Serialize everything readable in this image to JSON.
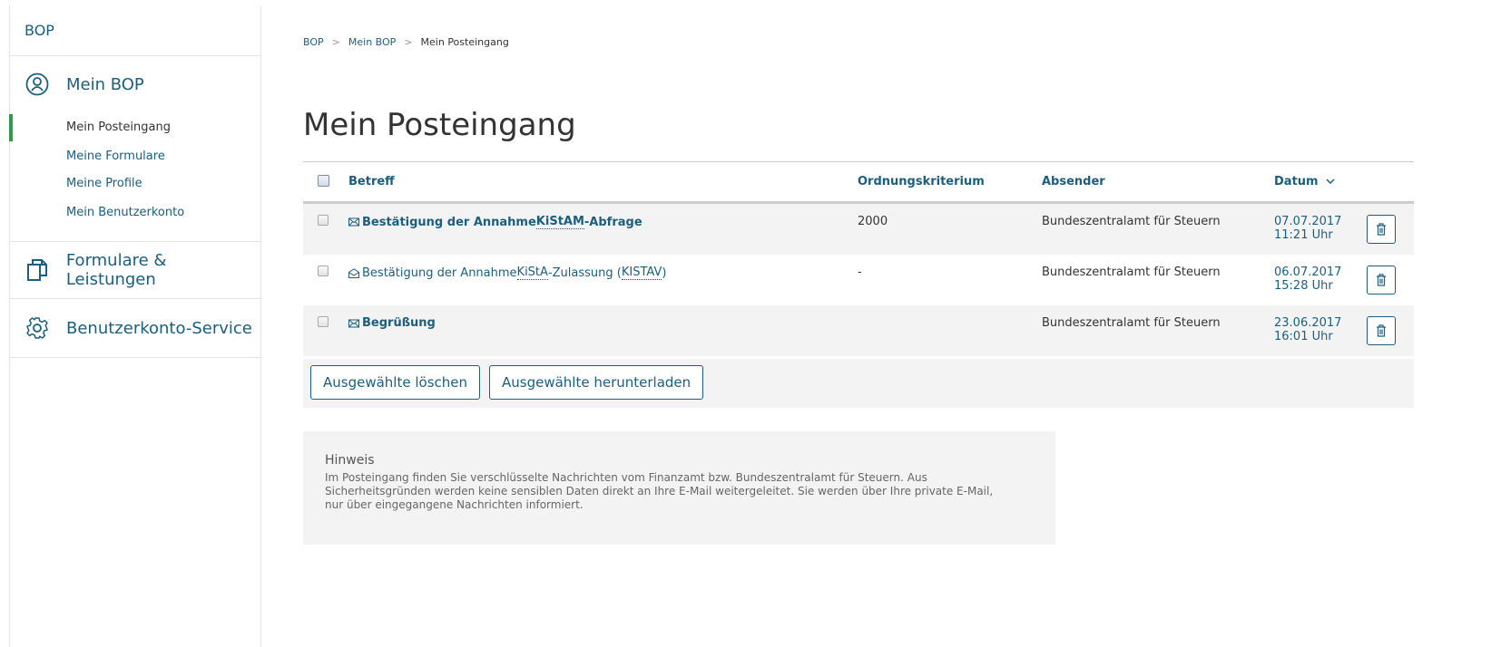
{
  "sidebar": {
    "brand": "BOP",
    "sections": [
      {
        "label": "Mein BOP",
        "icon": "user-circle-icon"
      },
      {
        "label": "Formulare & Leistungen",
        "icon": "documents-icon"
      },
      {
        "label": "Benutzerkonto-Service",
        "icon": "gear-icon"
      }
    ],
    "subnav": [
      "Mein Posteingang",
      "Meine Formulare",
      "Meine Profile",
      "Mein Benutzerkonto"
    ],
    "active": "Mein Posteingang"
  },
  "breadcrumb": [
    "BOP",
    "Mein BOP",
    "Mein Posteingang"
  ],
  "page_title": "Mein Posteingang",
  "table": {
    "headers": {
      "subject": "Betreff",
      "criterion": "Ordnungskriterium",
      "sender": "Absender",
      "date": "Datum"
    },
    "sort_icon": "chevron-down-icon",
    "rows": [
      {
        "subject_pre": "Bestätigung der Annahme ",
        "subject_abbr": "KiStAM",
        "subject_post": "-Abfrage",
        "criterion": "2000",
        "sender": "Bundeszentralamt für Steuern",
        "date": "07.07.2017",
        "time": "11:21 Uhr",
        "read": false,
        "icon": "envelope-icon"
      },
      {
        "subject_pre": "Bestätigung der Annahme ",
        "subject_abbr": "KiStA",
        "subject_post": "-Zulassung (",
        "subject_abbr2": "KISTAV",
        "subject_end": ")",
        "criterion": "-",
        "sender": "Bundeszentralamt für Steuern",
        "date": "06.07.2017",
        "time": "15:28 Uhr",
        "read": true,
        "icon": "envelope-open-icon"
      },
      {
        "subject_pre": "Begrüßung",
        "criterion": "",
        "sender": "Bundeszentralamt für Steuern",
        "date": "23.06.2017",
        "time": "16:01 Uhr",
        "read": false,
        "icon": "envelope-icon"
      }
    ]
  },
  "actions": {
    "delete_selected": "Ausgewählte löschen",
    "download_selected": "Ausgewählte herunterladen"
  },
  "note": {
    "title": "Hinweis",
    "text_1": "Im Posteingang finden Sie verschlüsselte Nachrichten vom Finanzamt bzw. Bundeszentralamt für Steuern. Aus",
    "text_2": "Sicherheitsgründen werden keine sensiblen Daten direkt an Ihre E-Mail weitergeleitet. Sie werden über Ihre private E-Mail,",
    "text_3": "nur über eingegangene Nachrichten informiert."
  },
  "colors": {
    "accent": "#1b5e7e",
    "active_marker": "#2e9d4b",
    "row_stripe": "#f3f3f3"
  }
}
